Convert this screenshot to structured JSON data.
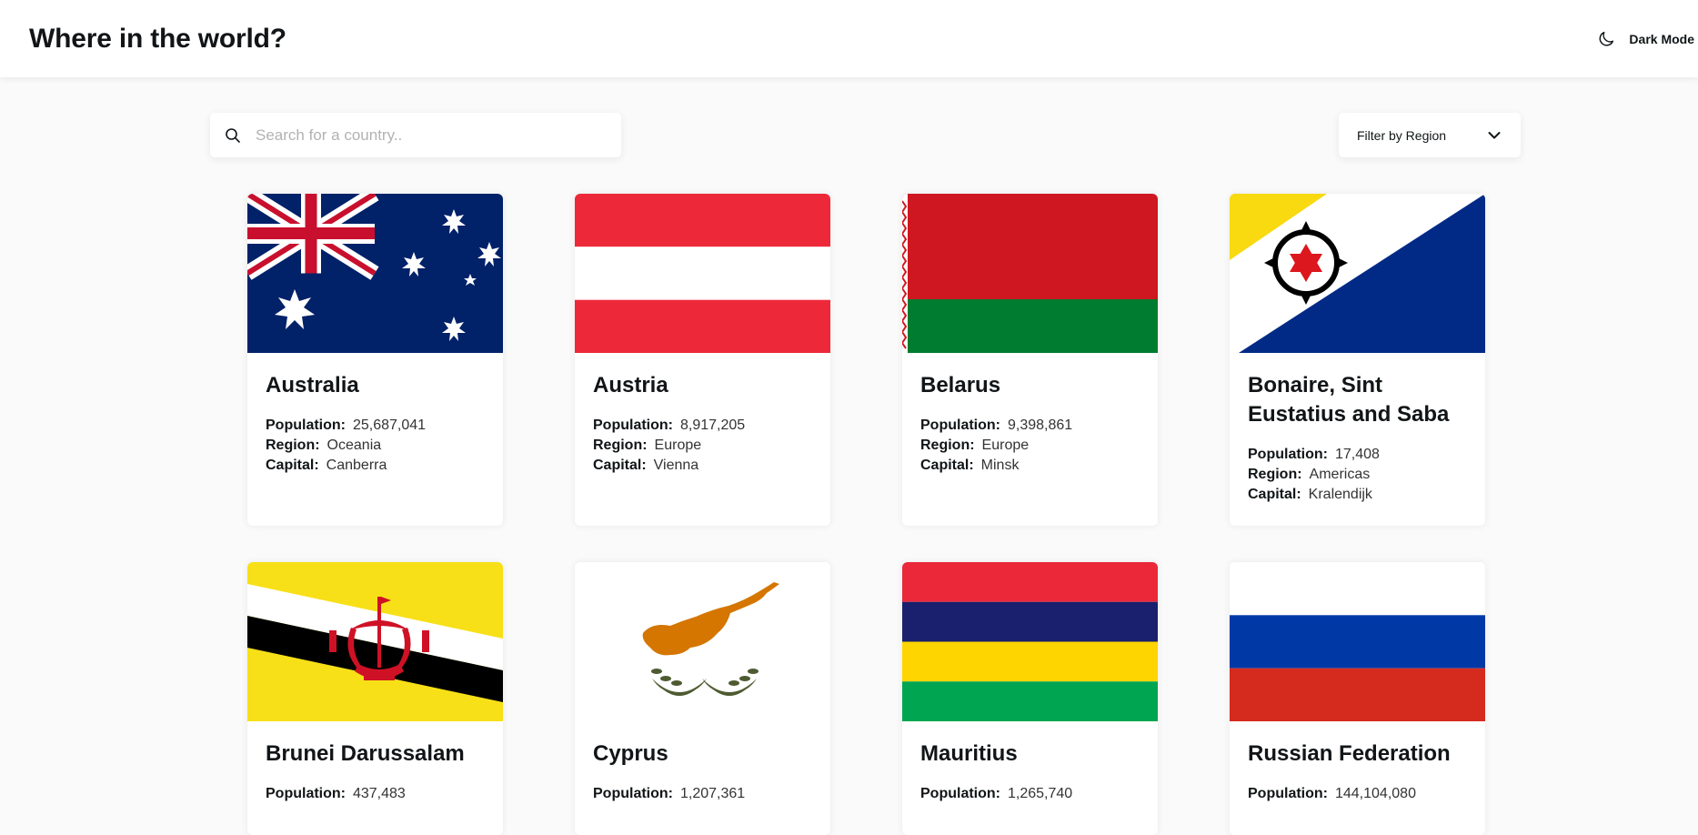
{
  "header": {
    "title": "Where in the world?",
    "mode_label": "Dark Mode",
    "mode_icon": "moon-icon"
  },
  "search": {
    "placeholder": "Search for a country..",
    "value": "",
    "icon": "search-icon"
  },
  "filter": {
    "label": "Filter by Region",
    "icon": "chevron-down-icon"
  },
  "field_labels": {
    "population": "Population:",
    "region": "Region:",
    "capital": "Capital:"
  },
  "countries": [
    {
      "name": "Australia",
      "population": "25,687,041",
      "region": "Oceania",
      "capital": "Canberra",
      "flag": "australia-flag"
    },
    {
      "name": "Austria",
      "population": "8,917,205",
      "region": "Europe",
      "capital": "Vienna",
      "flag": "austria-flag"
    },
    {
      "name": "Belarus",
      "population": "9,398,861",
      "region": "Europe",
      "capital": "Minsk",
      "flag": "belarus-flag"
    },
    {
      "name": "Bonaire, Sint Eustatius and Saba",
      "population": "17,408",
      "region": "Americas",
      "capital": "Kralendijk",
      "flag": "bonaire-flag"
    },
    {
      "name": "Brunei Darussalam",
      "population": "437,483",
      "region": "",
      "capital": "",
      "flag": "brunei-flag"
    },
    {
      "name": "Cyprus",
      "population": "1,207,361",
      "region": "",
      "capital": "",
      "flag": "cyprus-flag"
    },
    {
      "name": "Mauritius",
      "population": "1,265,740",
      "region": "",
      "capital": "",
      "flag": "mauritius-flag"
    },
    {
      "name": "Russian Federation",
      "population": "144,104,080",
      "region": "",
      "capital": "",
      "flag": "russia-flag"
    }
  ],
  "colors": {
    "background": "#fafafa",
    "card": "#ffffff",
    "text": "#111517"
  }
}
